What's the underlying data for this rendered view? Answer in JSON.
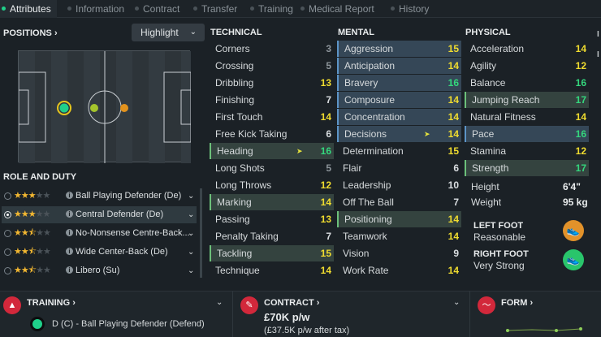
{
  "tabs": [
    "Attributes",
    "Information",
    "Contract",
    "Transfer",
    "Training",
    "Medical Report",
    "History"
  ],
  "positions_label": "POSITIONS",
  "highlight_label": "Highlight",
  "role_duty_label": "ROLE AND DUTY",
  "roles": [
    {
      "name": "Ball Playing Defender (De)",
      "stars": 3,
      "half": false
    },
    {
      "name": "Central Defender (De)",
      "stars": 3,
      "half": false
    },
    {
      "name": "No-Nonsense Centre-Back...",
      "stars": 2,
      "half": true
    },
    {
      "name": "Wide Center-Back (De)",
      "stars": 2,
      "half": true
    },
    {
      "name": "Libero (Su)",
      "stars": 2,
      "half": true
    }
  ],
  "technical_label": "TECHNICAL",
  "mental_label": "MENTAL",
  "physical_label": "PHYSICAL",
  "technical": [
    {
      "name": "Corners",
      "value": "3"
    },
    {
      "name": "Crossing",
      "value": "5"
    },
    {
      "name": "Dribbling",
      "value": "13"
    },
    {
      "name": "Finishing",
      "value": "7"
    },
    {
      "name": "First Touch",
      "value": "14"
    },
    {
      "name": "Free Kick Taking",
      "value": "6"
    },
    {
      "name": "Heading",
      "value": "16",
      "hl": "g",
      "arrow": true
    },
    {
      "name": "Long Shots",
      "value": "5"
    },
    {
      "name": "Long Throws",
      "value": "12"
    },
    {
      "name": "Marking",
      "value": "14",
      "hl": "g"
    },
    {
      "name": "Passing",
      "value": "13"
    },
    {
      "name": "Penalty Taking",
      "value": "7"
    },
    {
      "name": "Tackling",
      "value": "15",
      "hl": "g"
    },
    {
      "name": "Technique",
      "value": "14"
    }
  ],
  "mental": [
    {
      "name": "Aggression",
      "value": "15",
      "hl": "b"
    },
    {
      "name": "Anticipation",
      "value": "14",
      "hl": "b"
    },
    {
      "name": "Bravery",
      "value": "16",
      "hl": "b"
    },
    {
      "name": "Composure",
      "value": "14",
      "hl": "b"
    },
    {
      "name": "Concentration",
      "value": "14",
      "hl": "b"
    },
    {
      "name": "Decisions",
      "value": "14",
      "hl": "b",
      "arrow": true
    },
    {
      "name": "Determination",
      "value": "15"
    },
    {
      "name": "Flair",
      "value": "6"
    },
    {
      "name": "Leadership",
      "value": "10"
    },
    {
      "name": "Off The Ball",
      "value": "7"
    },
    {
      "name": "Positioning",
      "value": "14",
      "hl": "g"
    },
    {
      "name": "Teamwork",
      "value": "14"
    },
    {
      "name": "Vision",
      "value": "9"
    },
    {
      "name": "Work Rate",
      "value": "14"
    }
  ],
  "physical": [
    {
      "name": "Acceleration",
      "value": "14"
    },
    {
      "name": "Agility",
      "value": "12"
    },
    {
      "name": "Balance",
      "value": "16"
    },
    {
      "name": "Jumping Reach",
      "value": "17",
      "hl": "g"
    },
    {
      "name": "Natural Fitness",
      "value": "14"
    },
    {
      "name": "Pace",
      "value": "16",
      "hl": "b"
    },
    {
      "name": "Stamina",
      "value": "12"
    },
    {
      "name": "Strength",
      "value": "17",
      "hl": "g"
    }
  ],
  "height_label": "Height",
  "height": "6'4\"",
  "weight_label": "Weight",
  "weight": "95 kg",
  "left_foot_label": "LEFT FOOT",
  "left_foot": "Reasonable",
  "right_foot_label": "RIGHT FOOT",
  "right_foot": "Very Strong",
  "training_label": "TRAINING",
  "training_value": "D (C) - Ball Playing Defender (Defend)",
  "contract_label": "CONTRACT",
  "contract_wage": "£70K p/w",
  "contract_after_tax": "(£37.5K p/w after tax)",
  "form_label": "FORM",
  "colors": {
    "accent_green": "#1fd08a",
    "highlight_green": "#34433f",
    "highlight_blue": "#354757",
    "value_yellow": "#f0dc2f",
    "value_green": "#34d77d",
    "star": "#f2b731",
    "red_icon": "#d2283b"
  }
}
